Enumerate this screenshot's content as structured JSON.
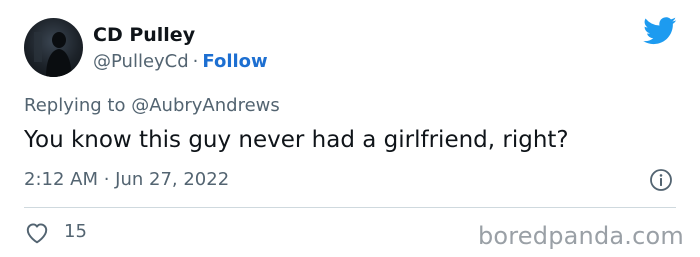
{
  "author": {
    "display_name": "CD Pulley",
    "handle": "@PulleyCd",
    "separator": "·",
    "follow_label": "Follow"
  },
  "reply": {
    "prefix": "Replying to",
    "target": "@AubryAndrews"
  },
  "tweet": {
    "text": "You know this guy never had a girlfriend, right?",
    "timestamp": "2:12 AM · Jun 27, 2022"
  },
  "engagement": {
    "like_count": "15"
  },
  "watermark": {
    "text": "boredpanda.com"
  },
  "colors": {
    "twitter_blue": "#1d9bf0",
    "follow_blue": "#1d6fd1",
    "secondary_text": "#536471",
    "primary_text": "#0f1419",
    "divider": "#cfd9de",
    "watermark_gray": "#9aa0a6"
  },
  "icons": {
    "brand": "twitter-bird-icon",
    "info": "info-icon",
    "like": "heart-icon"
  }
}
